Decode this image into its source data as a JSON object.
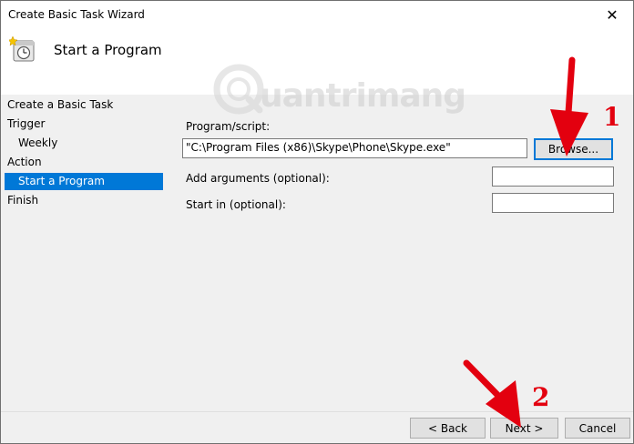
{
  "window": {
    "title": "Create Basic Task Wizard",
    "close_glyph": "✕"
  },
  "header": {
    "title": "Start a Program",
    "icon": "task-scheduler-clock-icon"
  },
  "watermark": {
    "text": "uantrimang"
  },
  "sidebar": {
    "items": [
      {
        "label": "Create a Basic Task"
      },
      {
        "label": "Trigger"
      },
      {
        "label": "Weekly"
      },
      {
        "label": "Action"
      },
      {
        "label": "Start a Program",
        "selected": true
      },
      {
        "label": "Finish"
      }
    ],
    "selected_color": "#0078d7"
  },
  "form": {
    "program_label": "Program/script:",
    "program_value": "\"C:\\Program Files (x86)\\Skype\\Phone\\Skype.exe\"",
    "browse_label": "Browse...",
    "arguments_label": "Add arguments (optional):",
    "arguments_value": "",
    "start_in_label": "Start in (optional):",
    "start_in_value": ""
  },
  "footer": {
    "back_label": "< Back",
    "next_label": "Next >",
    "cancel_label": "Cancel"
  },
  "annotations": {
    "marker_1": "1",
    "marker_2": "2",
    "color": "#e3000f"
  }
}
